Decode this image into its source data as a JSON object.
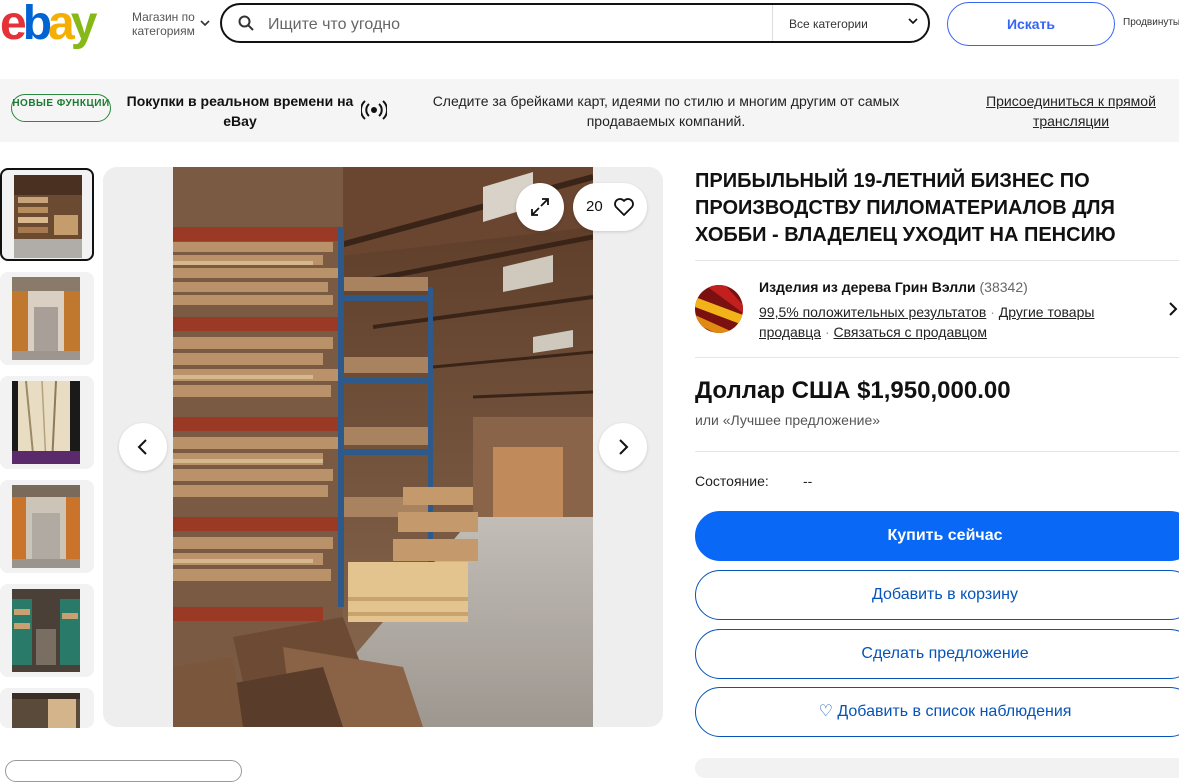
{
  "header": {
    "logo_letters": [
      "e",
      "b",
      "a",
      "y"
    ],
    "logo_colors": [
      "#e53238",
      "#0064d2",
      "#f5af02",
      "#86b817"
    ],
    "shop_by_category": "Магазин по категориям",
    "search_placeholder": "Ищите что угодно",
    "category_select": "Все категории",
    "search_button": "Искать",
    "advanced_link": "Продвинутый"
  },
  "banner": {
    "badge": "НОВЫЕ ФУНКЦИИ",
    "title": "Покупки в реальном времени на eBay",
    "description": "Следите за брейками карт, идеями по стилю и многим другим от самых продаваемых компаний.",
    "link": "Присоединиться к прямой трансляции"
  },
  "gallery": {
    "watch_count": "20",
    "icons": {
      "expand": "expand-icon",
      "heart": "heart-icon",
      "prev": "chevron-left-icon",
      "next": "chevron-right-icon"
    }
  },
  "listing": {
    "title": "ПРИБЫЛЬНЫЙ 19-ЛЕТНИЙ БИЗНЕС ПО ПРОИЗВОДСТВУ ПИЛОМАТЕРИАЛОВ ДЛЯ ХОББИ - ВЛАДЕЛЕЦ УХОДИТ НА ПЕНСИЮ",
    "seller": {
      "name": "Изделия из дерева Грин Вэлли",
      "feedback_count": "(38342)",
      "positive": "99,5% положительных результатов",
      "other_items": "Другие товары продавца",
      "contact": "Связаться с продавцом",
      "separator": "·"
    },
    "price": "Доллар США $1,950,000.00",
    "best_offer": "или «Лучшее предложение»",
    "condition_label": "Состояние:",
    "condition_value": "--",
    "buttons": {
      "buy_now": "Купить сейчас",
      "add_to_cart": "Добавить в корзину",
      "make_offer": "Сделать предложение",
      "watchlist": "♡ Добавить в список наблюдения"
    }
  },
  "colors": {
    "accent_blue": "#3665f3",
    "buy_blue": "#0968f6",
    "link_blue": "#0654ba"
  }
}
